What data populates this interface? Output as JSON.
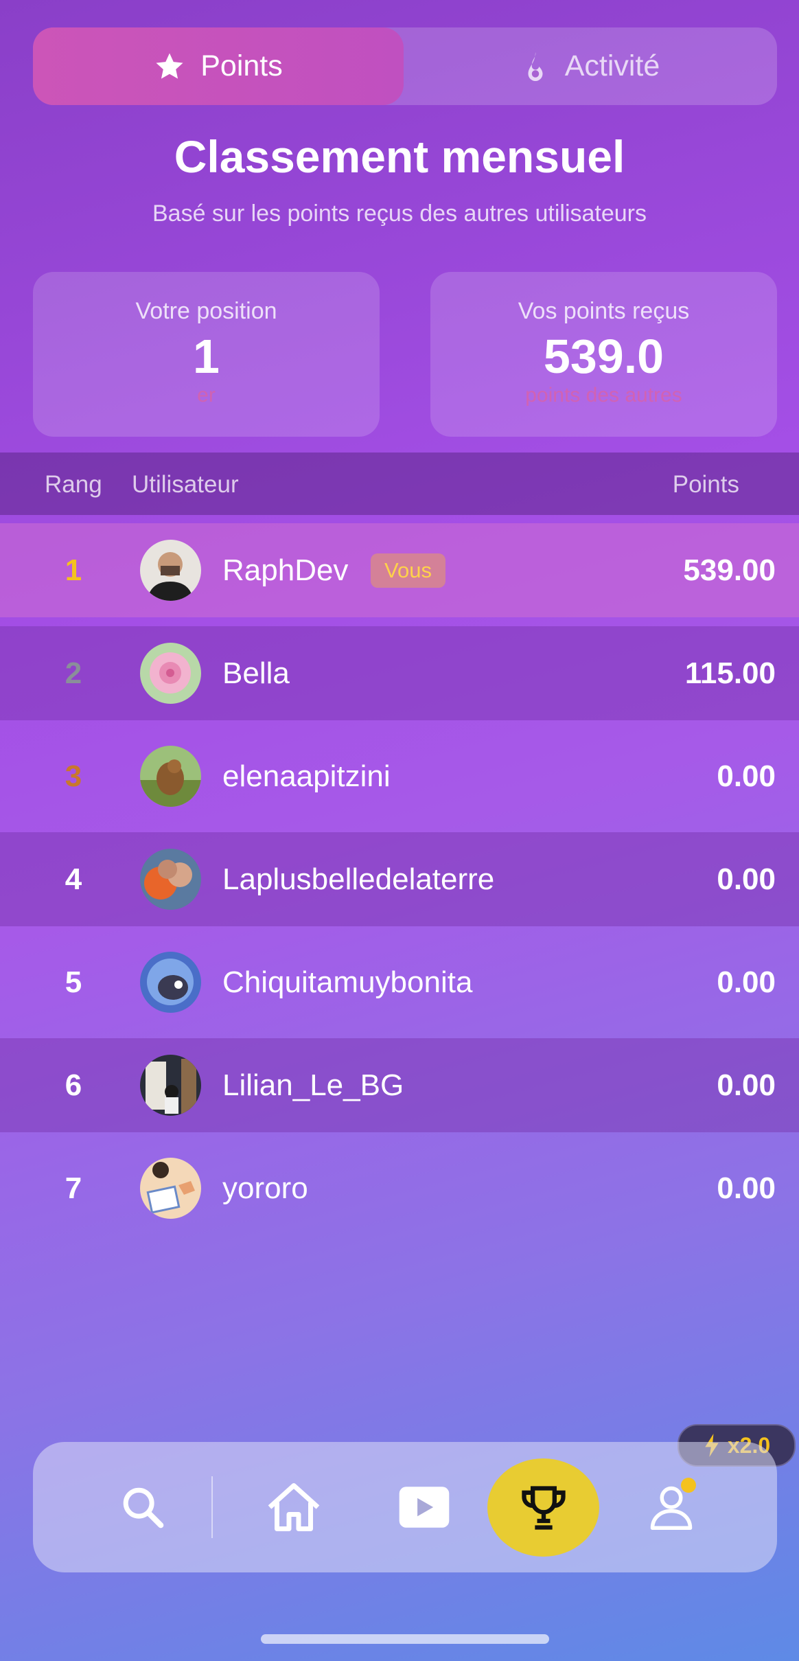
{
  "tabs": [
    {
      "label": "Points",
      "icon": "star-icon",
      "active": true
    },
    {
      "label": "Activité",
      "icon": "flame-icon",
      "active": false
    }
  ],
  "header": {
    "title": "Classement mensuel",
    "subtitle": "Basé sur les points reçus des autres utilisateurs"
  },
  "cards": {
    "position": {
      "label": "Votre position",
      "value": "1",
      "suffix": "er"
    },
    "points": {
      "label": "Vos points reçus",
      "value": "539.0",
      "suffix": "points des autres"
    }
  },
  "table": {
    "headers": {
      "rank": "Rang",
      "user": "Utilisateur",
      "points": "Points"
    },
    "you_badge": "Vous",
    "rows": [
      {
        "rank": "1",
        "name": "RaphDev",
        "points": "539.00",
        "is_you": true
      },
      {
        "rank": "2",
        "name": "Bella",
        "points": "115.00"
      },
      {
        "rank": "3",
        "name": "elenaapitzini",
        "points": "0.00"
      },
      {
        "rank": "4",
        "name": "Laplusbelledelaterre",
        "points": "0.00"
      },
      {
        "rank": "5",
        "name": "Chiquitamuybonita",
        "points": "0.00"
      },
      {
        "rank": "6",
        "name": "Lilian_Le_BG",
        "points": "0.00"
      },
      {
        "rank": "7",
        "name": "yororo",
        "points": "0.00"
      }
    ]
  },
  "boost": {
    "label": "x2.0",
    "icon": "lightning-icon"
  },
  "nav": [
    "search-icon",
    "home-icon",
    "video-icon",
    "trophy-icon",
    "profile-icon"
  ],
  "colors": {
    "accent": "#e8cc32",
    "rank1": "#f4c21e",
    "rank2": "#8a8f9a",
    "rank3": "#c9782c"
  }
}
